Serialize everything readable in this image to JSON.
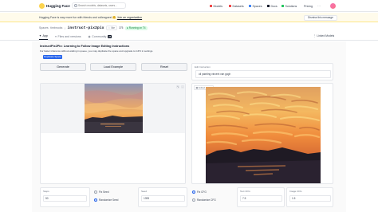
{
  "nav": {
    "brand": "Hugging Face",
    "search_placeholder": "Search models, datasets, users...",
    "items": [
      {
        "label": "Models",
        "color": "#ef4444"
      },
      {
        "label": "Datasets",
        "color": "#ef4444"
      },
      {
        "label": "Spaces",
        "color": "#3b82f6"
      },
      {
        "label": "Docs",
        "color": "#111827"
      },
      {
        "label": "Solutions",
        "color": "#22c55e"
      },
      {
        "label": "Pricing",
        "color": ""
      }
    ],
    "more": "···"
  },
  "banner": {
    "text": "Hugging Face is way more fun with friends and colleagues! 🤗",
    "link": "Join an organization",
    "dismiss": "Dismiss this message"
  },
  "space": {
    "label": "Spaces",
    "owner": "timbrooks",
    "name": "instruct-pix2pix",
    "like": "♡ like",
    "likes": "375",
    "status": "● Running on T4"
  },
  "tabs": [
    {
      "label": "App",
      "active": true
    },
    {
      "label": "Files and versions",
      "active": false
    },
    {
      "label": "Community",
      "badge": "28",
      "active": false
    }
  ],
  "linked_models": "⋮ Linked Models",
  "app": {
    "title": "InstructPix2Pix: Learning to Follow Image Editing Instructions",
    "description": "For faster inference without waiting in queue, you may duplicate the space and upgrade to GPU in settings.",
    "duplicate": "Duplicate Space",
    "buttons": {
      "generate": "Generate",
      "load_example": "Load Example",
      "reset": "Reset"
    },
    "instruction_label": "Edit Instruction",
    "instruction_value": "oil painting vincent van gogh",
    "input_label": "Input Image",
    "output_label": "Edited Image",
    "steps_label": "Steps",
    "steps_value": "50",
    "seed_mode": {
      "fix": "Fix Seed",
      "random": "Randomize Seed"
    },
    "seed_label": "Seed",
    "seed_value": "1395",
    "cfg_mode": {
      "fix": "Fix CFG",
      "random": "Randomize CFG"
    },
    "text_cfg_label": "Text CFG",
    "text_cfg_value": "7.5",
    "image_cfg_label": "Image CFG",
    "image_cfg_value": "1.5"
  }
}
